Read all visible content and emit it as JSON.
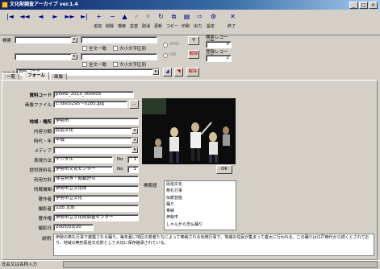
{
  "window": {
    "title": "文化財調査アーカイブ ver.1.4"
  },
  "toolbar": {
    "nav": [
      "|◄",
      "◄◄",
      "◄",
      "►",
      "►►",
      "►|"
    ],
    "buttons": [
      "追加",
      "削除",
      "検索",
      "並替",
      "取消",
      "更新",
      "コピー",
      "印刷",
      "出力",
      "設定",
      "終了"
    ]
  },
  "search": {
    "label": "検索",
    "combo1": "",
    "combo2": "",
    "opt1a": "全文一致",
    "opt1b": "大小文字区別",
    "opt2a": "全文一致",
    "opt2b": "大小文字区別",
    "radio_and": "AND",
    "radio_or": "OR",
    "filter_label": "解除",
    "count_label": "検索レコード数",
    "count_value": "0",
    "total_label": "登録レコード数",
    "total_value": "2"
  },
  "sort": {
    "label": "ソート",
    "value": "資料コード",
    "release": "解除"
  },
  "tabs": [
    "一覧",
    "フォーム",
    "画像"
  ],
  "form": {
    "code_label": "資料コード",
    "code_value": "photo_2013_000005",
    "file_label": "画像ファイル",
    "file_value": "c:\\dsc0295～0285.jpg",
    "file_btn": "...",
    "place_label": "地域・場所",
    "place_value": "伊勢市",
    "content_label": "内容分類",
    "content_value": "民俗文化",
    "period_label": "時代・年",
    "period_value": "平成",
    "media_label": "メディア",
    "media_value": "",
    "scale_label": "表現方法",
    "scale_value": "デジタル",
    "scale_no": "No",
    "scale_num": "1",
    "source_label": "提供資料名",
    "source_value": "伊勢市文化センター",
    "source_no": "No",
    "source_num": "1",
    "use_label": "利用方針",
    "use_value": "非営利等・転載許可",
    "owner_label": "所蔵機関",
    "owner_value": "伊勢市立文化財",
    "holder_label": "著作者",
    "holder_value": "伊勢市立文化",
    "photo_label": "撮影者",
    "photo_value": "山田 太郎",
    "dept_label": "著作権",
    "dept_value": "伊勢市立文化財調査センター",
    "date_label": "撮影日",
    "date_value": "2005/03/20",
    "memo_label": "説明",
    "memo_text": "伊勢の祭礼行事で披露される踊り。毎年夏に地区の若者たちによって奉納される伝統行事で、地域の住民が集まって盛大に行われる。この踊りは江戸時代から続くとされており、地域の無形民俗文化財として大切に保存継承されている。",
    "ok_btn": "OK",
    "kw_label": "検索語",
    "keywords": [
      "民俗文化",
      "祭礼行事",
      "伝統芸能",
      "踊り",
      "奉納",
      "伊勢市",
      "しゃんがら念仏踊り"
    ]
  },
  "status": {
    "text": "氏名又は名称入力"
  }
}
